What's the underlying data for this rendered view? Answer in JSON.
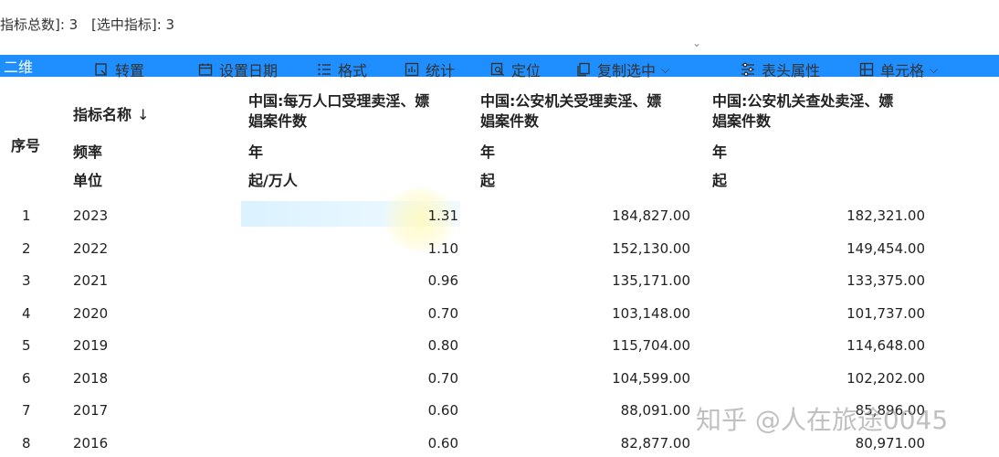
{
  "summary": {
    "total_label": "指标总数]: 3",
    "selected_label": "[选中指标]: 3"
  },
  "toolbar": {
    "active_tab": "二维",
    "items": [
      {
        "label": "转置",
        "icon": "transpose-icon"
      },
      {
        "label": "设置日期",
        "icon": "calendar-icon"
      },
      {
        "label": "格式",
        "icon": "list-format-icon"
      },
      {
        "label": "统计",
        "icon": "bar-chart-icon"
      },
      {
        "label": "定位",
        "icon": "locate-icon"
      },
      {
        "label": "复制选中",
        "icon": "copy-icon"
      },
      {
        "label": "表头属性",
        "icon": "sliders-icon"
      },
      {
        "label": "单元格",
        "icon": "table-cell-icon"
      }
    ]
  },
  "table": {
    "meta_headers": {
      "index": "序号",
      "indicator": "指标名称",
      "frequency": "频率",
      "unit": "单位"
    },
    "columns": [
      {
        "name_line1": "中国:每万人口受理卖淫、嫖",
        "name_line2": "娼案件数",
        "frequency": "年",
        "unit": "起/万人"
      },
      {
        "name_line1": "中国:公安机关受理卖淫、嫖",
        "name_line2": "娼案件数",
        "frequency": "年",
        "unit": "起"
      },
      {
        "name_line1": "中国:公安机关查处卖淫、嫖",
        "name_line2": "娼案件数",
        "frequency": "年",
        "unit": "起"
      }
    ],
    "rows": [
      {
        "idx": "1",
        "year": "2023",
        "v1": "1.31",
        "v2": "184,827.00",
        "v3": "182,321.00"
      },
      {
        "idx": "2",
        "year": "2022",
        "v1": "1.10",
        "v2": "152,130.00",
        "v3": "149,454.00"
      },
      {
        "idx": "3",
        "year": "2021",
        "v1": "0.96",
        "v2": "135,171.00",
        "v3": "133,375.00"
      },
      {
        "idx": "4",
        "year": "2020",
        "v1": "0.70",
        "v2": "103,148.00",
        "v3": "101,737.00"
      },
      {
        "idx": "5",
        "year": "2019",
        "v1": "0.80",
        "v2": "115,704.00",
        "v3": "114,648.00"
      },
      {
        "idx": "6",
        "year": "2018",
        "v1": "0.70",
        "v2": "104,599.00",
        "v3": "102,202.00"
      },
      {
        "idx": "7",
        "year": "2017",
        "v1": "0.60",
        "v2": "88,091.00",
        "v3": "85,896.00"
      },
      {
        "idx": "8",
        "year": "2016",
        "v1": "0.60",
        "v2": "82,877.00",
        "v3": "80,971.00"
      }
    ]
  },
  "watermark": "知乎 @人在旅途0045",
  "colors": {
    "accent": "#1f8fff",
    "highlight_band": "#d7f0ff",
    "highlight_blob": "#fffabe"
  }
}
